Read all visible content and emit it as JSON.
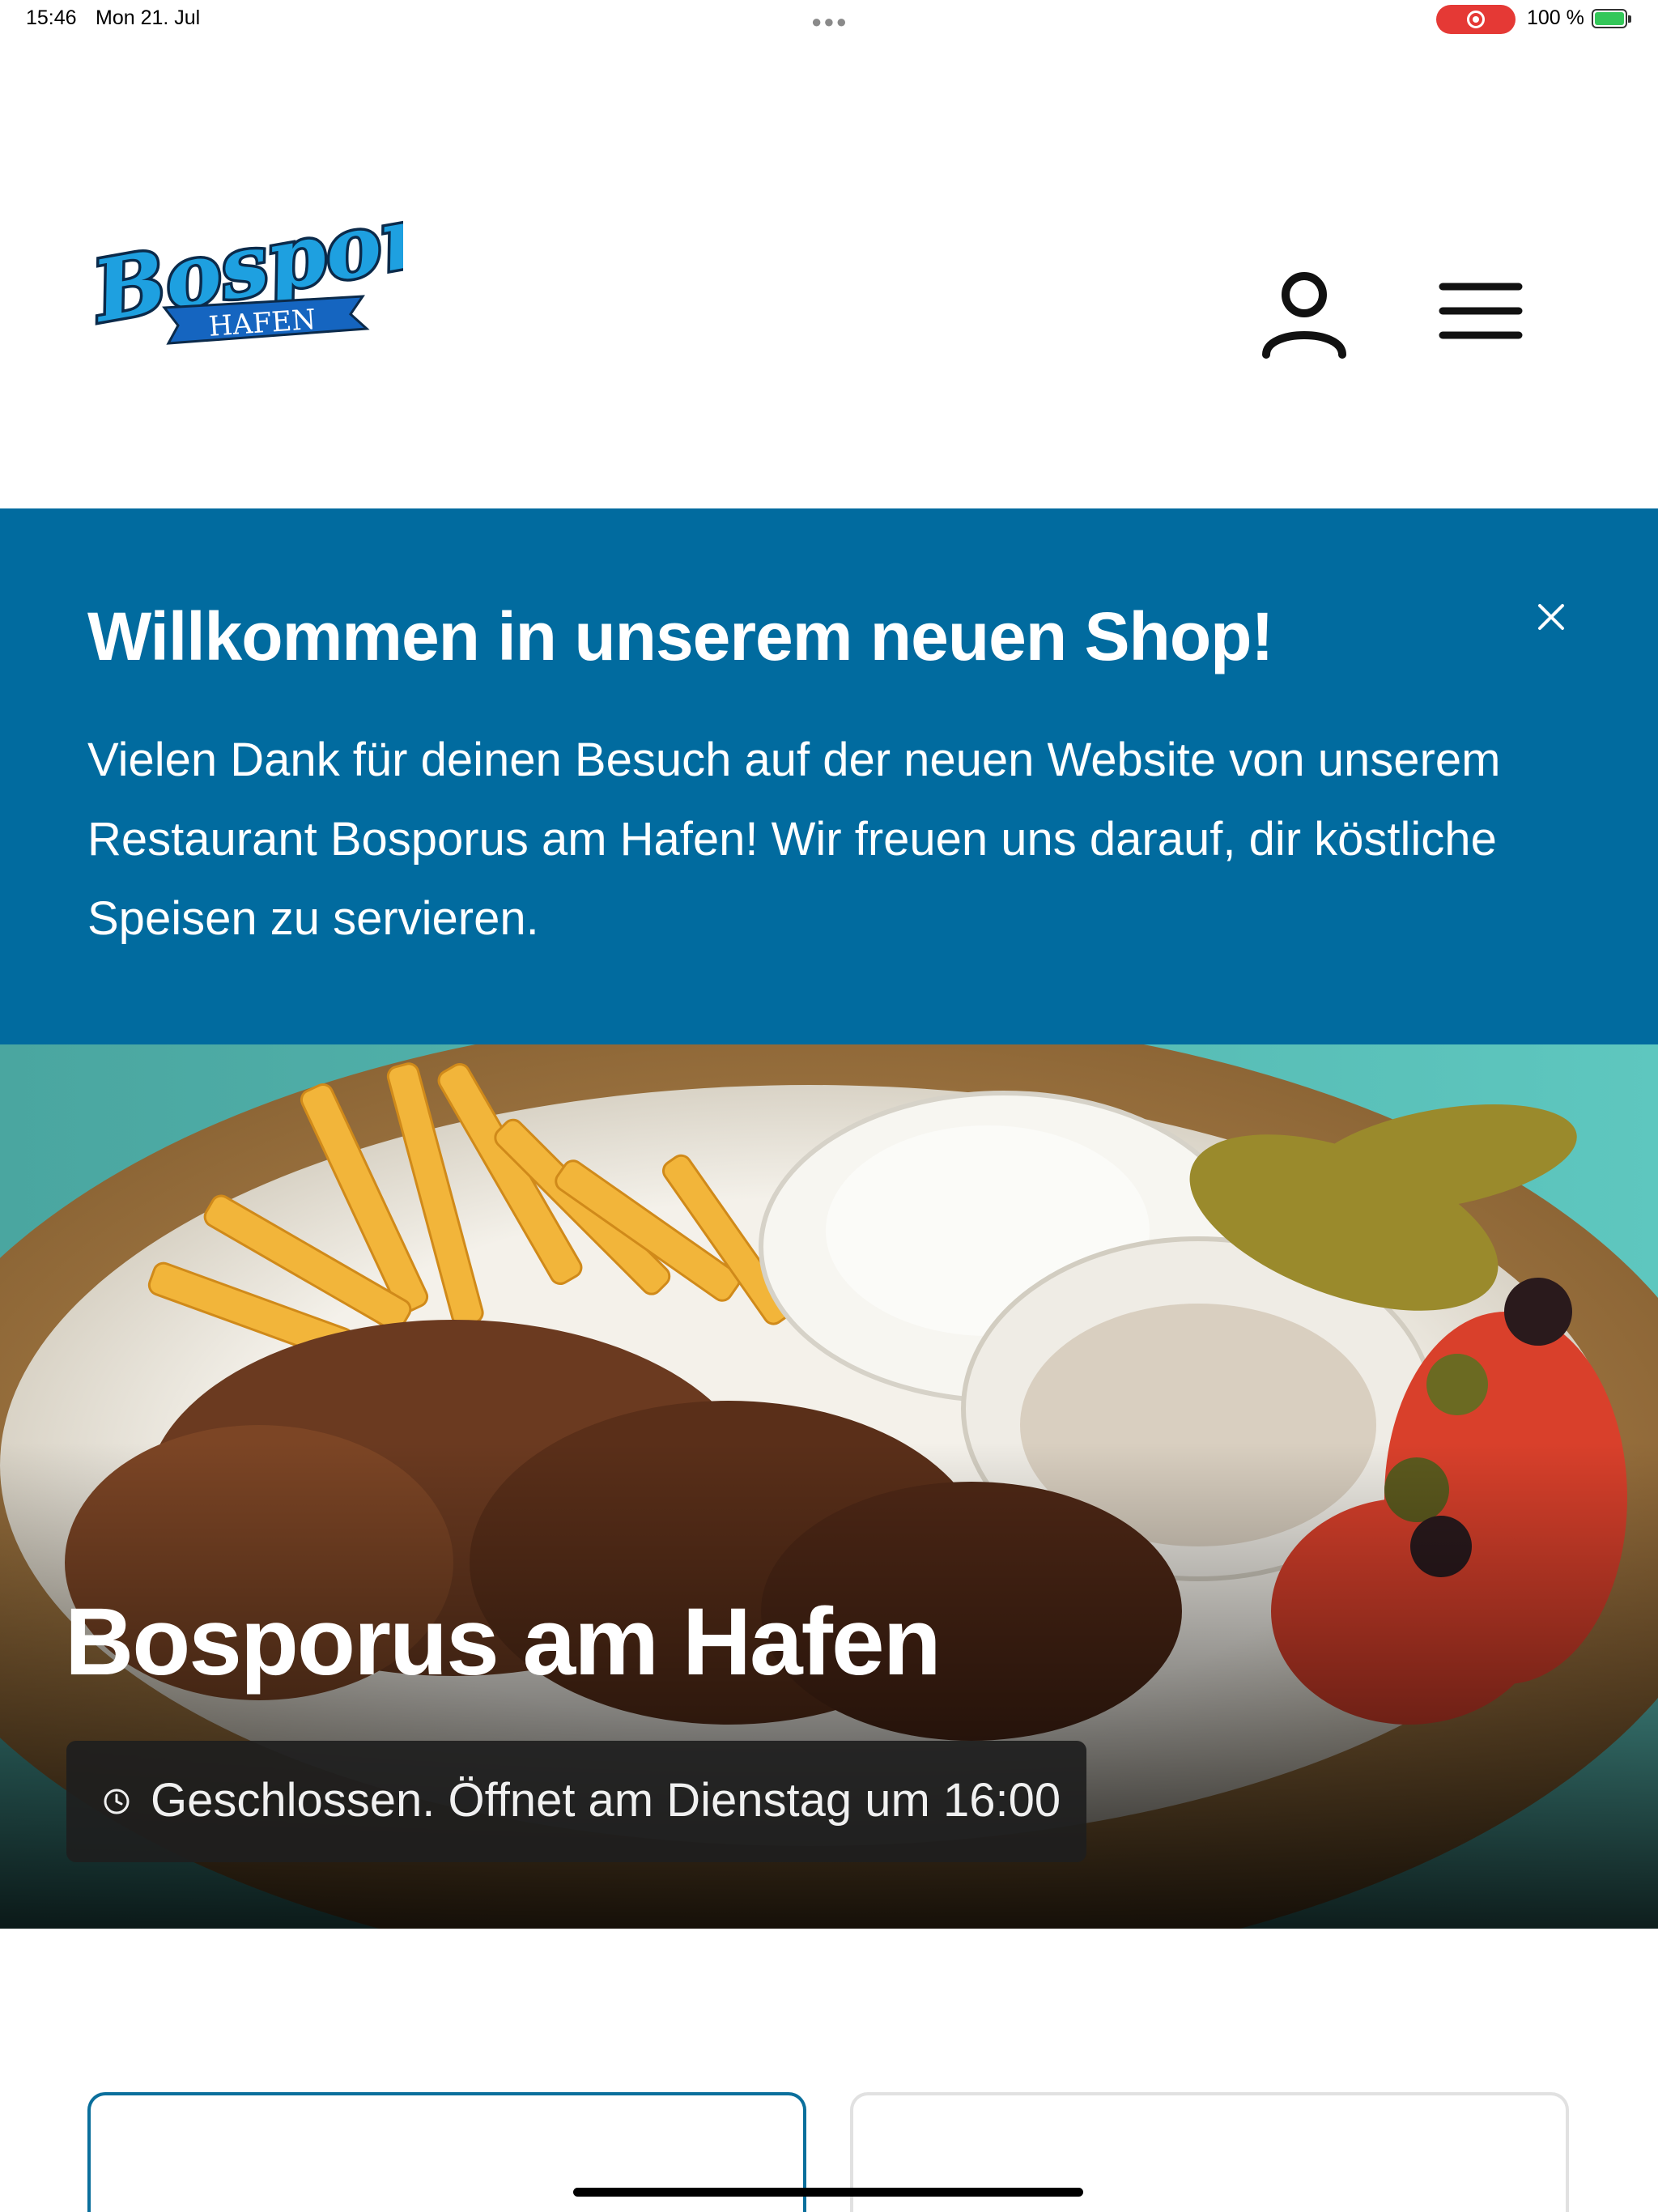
{
  "status_bar": {
    "time": "15:46",
    "date": "Mon 21. Jul",
    "battery": "100 %",
    "recording_color": "#e53935"
  },
  "header": {
    "logo": {
      "name": "Bosporus",
      "tagline": "HAFEN"
    },
    "icons": [
      "user-icon",
      "menu-icon"
    ]
  },
  "banner": {
    "background": "#016b9f",
    "title": "Willkommen in unserem neuen Shop!",
    "text": "Vielen Dank für deinen Besuch auf der neuen Website von unserem Restaurant Bosporus am Hafen! Wir freuen uns darauf, dir köstliche Speisen zu servieren."
  },
  "hero": {
    "title": "Bosporus am Hafen",
    "status": "Geschlossen. Öffnet am Dienstag um 16:00"
  }
}
